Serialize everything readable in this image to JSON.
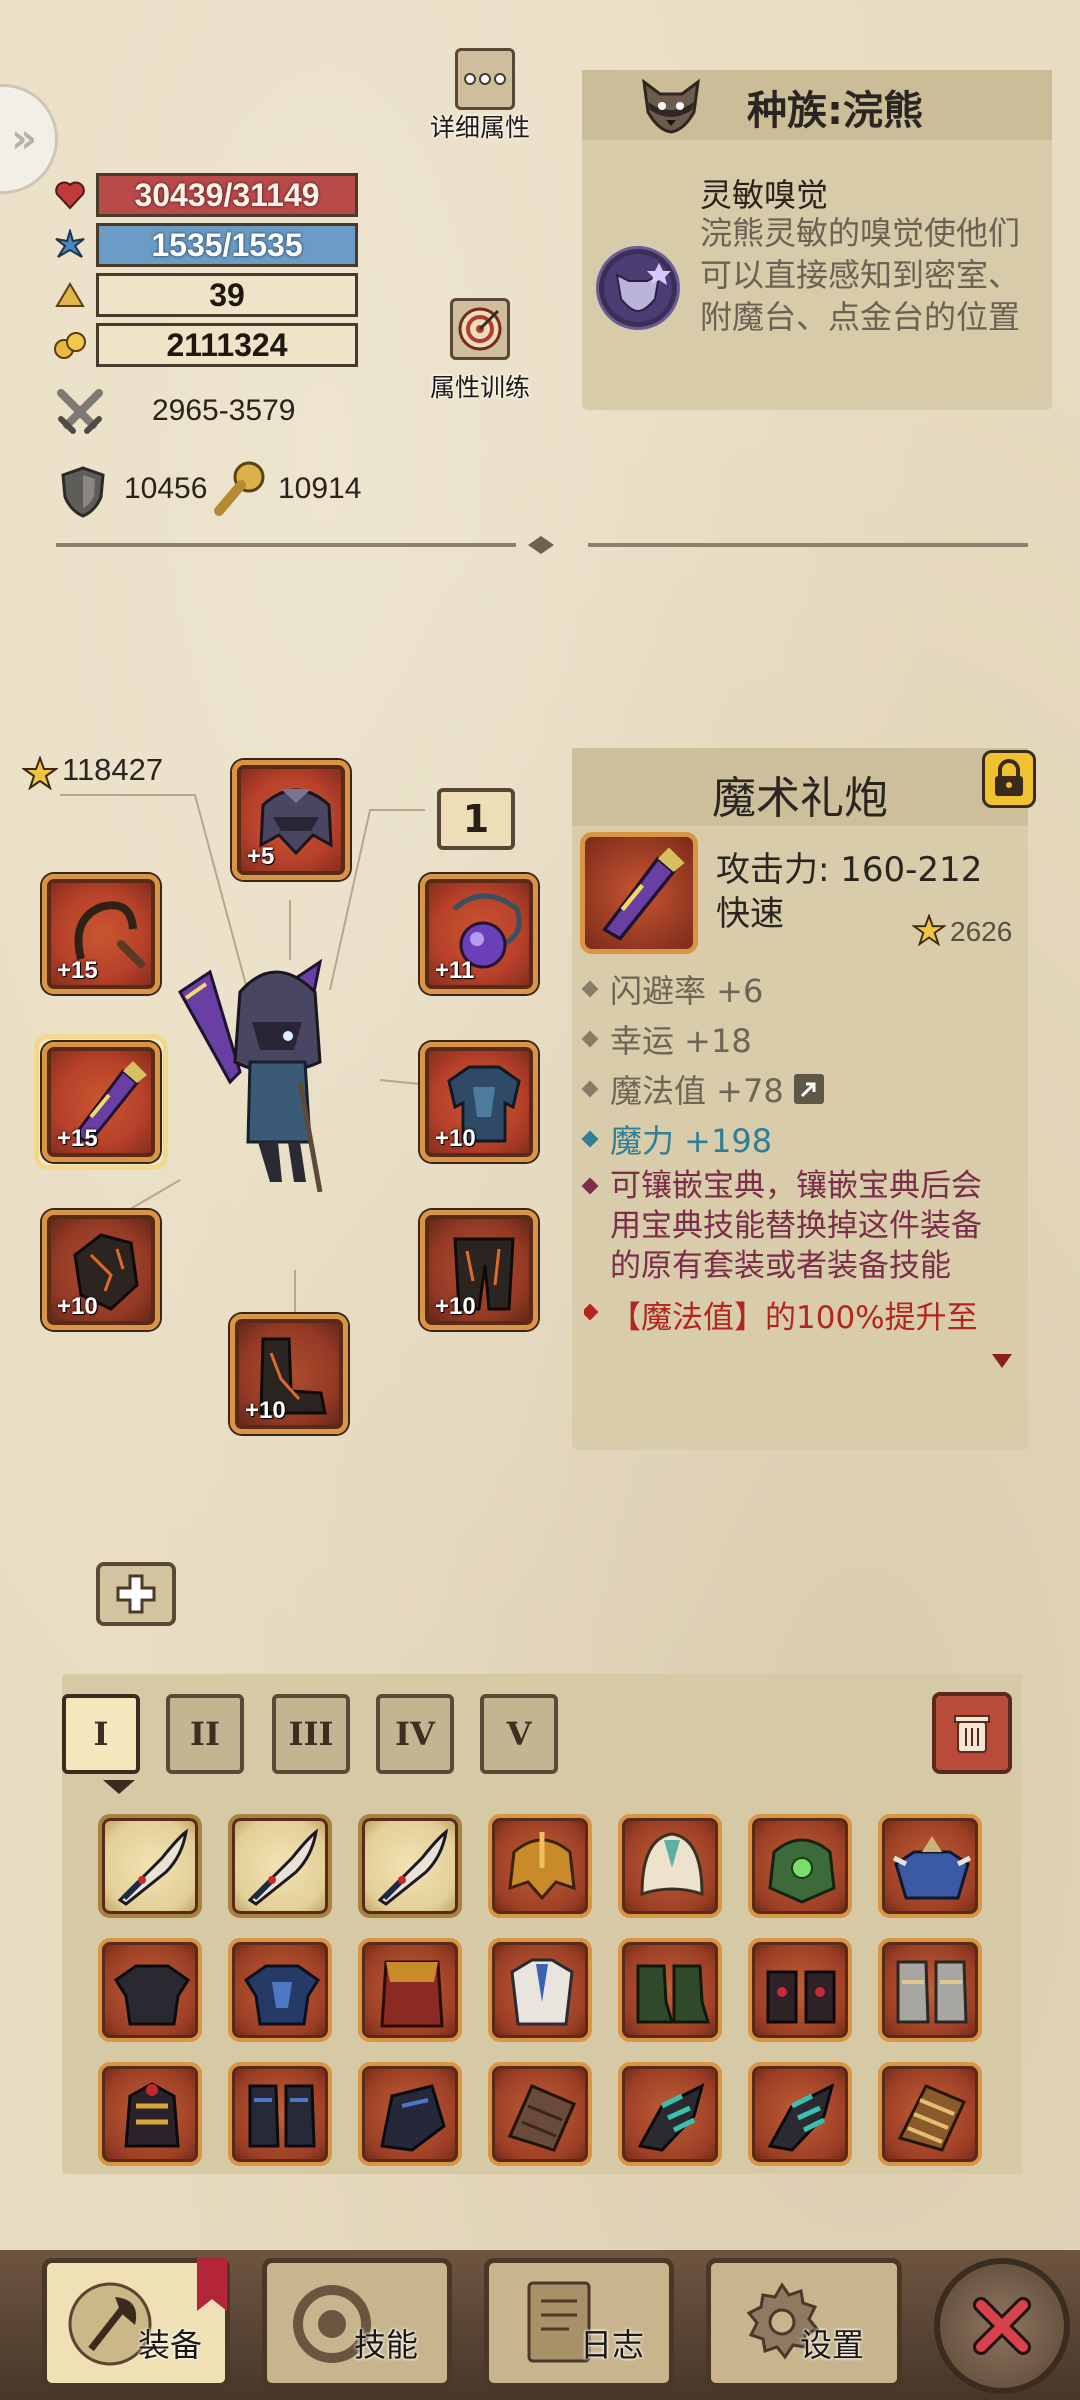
{
  "stats": {
    "hp": "30439/31149",
    "mp": "1535/1535",
    "level": "39",
    "gold": "2111324",
    "attack": "2965-3579",
    "armor": "10456",
    "magic_res": "10914"
  },
  "buttons": {
    "detail_attrs": "详细属性",
    "attr_training": "属性训练"
  },
  "race": {
    "title": "种族:浣熊",
    "skill_name": "灵敏嗅觉",
    "skill_desc": "浣熊灵敏的嗅觉使他们可以直接感知到密室、附魔台、点金台的位置"
  },
  "equipment": {
    "gear_score": "118427",
    "set_number": "1",
    "slots": {
      "helmet": "+5",
      "weapon_main": "+15",
      "weapon_off": "+15",
      "necklace": "+11",
      "chest": "+10",
      "gloves": "+10",
      "legs": "+10",
      "boots": "+10",
      "boots_center": "+10"
    }
  },
  "item": {
    "name": "魔术礼炮",
    "attack": "攻击力: 160-212",
    "speed": "快速",
    "score": "2626",
    "affixes": [
      {
        "text": "闪避率 +6",
        "color": "#6f6555"
      },
      {
        "text": "幸运 +18",
        "color": "#6f6555"
      },
      {
        "text": "魔法值 +78",
        "color": "#6f6555"
      },
      {
        "text": "魔力 +198",
        "color": "#2f7f95"
      }
    ],
    "special_desc": "可镶嵌宝典，镶嵌宝典后会用宝典技能替换掉这件装备的原有套装或者装备技能",
    "special_desc_lines": [
      "可镶嵌宝典，镶嵌宝典后会",
      "用宝典技能替换掉这件装备",
      "的原有套装或者装备技能"
    ],
    "effect_text": "【魔法值】的100%提升至"
  },
  "inventory": {
    "tabs": [
      "I",
      "II",
      "III",
      "IV",
      "V"
    ],
    "active_tab": "I"
  },
  "nav": {
    "equipment": "装备",
    "skills": "技能",
    "log": "日志",
    "settings": "设置"
  },
  "colors": {
    "hp_bar": "#b84a4a",
    "mp_bar": "#6a9cc6",
    "slot_frame": "#d99444",
    "magic_affix": "#2f7f95",
    "special_text": "#7a2e4a",
    "effect_text": "#b3261e"
  }
}
